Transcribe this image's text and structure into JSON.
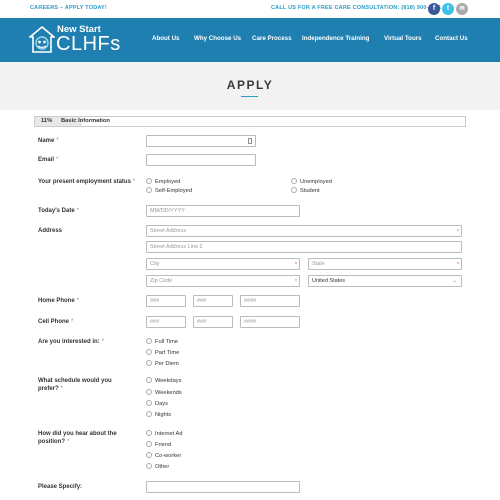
{
  "topbar": {
    "careers": "CAREERS – APPLY TODAY!",
    "call": "CALL US FOR A FREE CARE CONSULTATION: (818) 900-2711",
    "social": [
      {
        "icon": "facebook-icon",
        "glyph": "f"
      },
      {
        "icon": "twitter-icon",
        "glyph": "t"
      },
      {
        "icon": "email-icon",
        "glyph": "✉"
      }
    ]
  },
  "header": {
    "logo_line1": "New Start",
    "logo_line2": "CLHFs",
    "nav": [
      "About Us",
      "Why Choose Us",
      "Care Process",
      "Independence Training",
      "Virtual Tours",
      "Contact Us"
    ],
    "bg_color": "#1e7fb0"
  },
  "banner": {
    "title": "APPLY"
  },
  "progress": {
    "percent_label": "11%",
    "value": 0.11,
    "title": "Basic Information"
  },
  "form": {
    "required_mark": "*",
    "name": {
      "label": "Name"
    },
    "email": {
      "label": "Email"
    },
    "employment": {
      "label": "Your present employment status",
      "options": [
        "Employed",
        "Unemployed",
        "Self-Employed",
        "Student"
      ]
    },
    "date": {
      "label": "Today's Date",
      "placeholder": "MM/DD/YYYY"
    },
    "address": {
      "label": "Address",
      "street": "Street Address",
      "street2": "Street Address Line 2",
      "city": "City",
      "state": "State",
      "zip": "Zip Code",
      "country": "United States"
    },
    "home_phone": {
      "label": "Home Phone",
      "area": "###",
      "prefix": "###",
      "line": "####"
    },
    "cell_phone": {
      "label": "Cell Phone",
      "area": "###",
      "prefix": "###",
      "line": "####"
    },
    "interest": {
      "label": "Are you interested in:",
      "options": [
        "Full Time",
        "Part Time",
        "Per Diem"
      ]
    },
    "schedule": {
      "label_1": "What schedule would you",
      "label_2": "prefer?",
      "options": [
        "Weekdays",
        "Weekends",
        "Days",
        "Nights"
      ]
    },
    "hear": {
      "label_1": "How did you hear about the",
      "label_2": "position?",
      "options": [
        "Internet Ad",
        "Friend",
        "Co-worker",
        "Other"
      ]
    },
    "specify": {
      "label": "Please Specify:"
    }
  }
}
